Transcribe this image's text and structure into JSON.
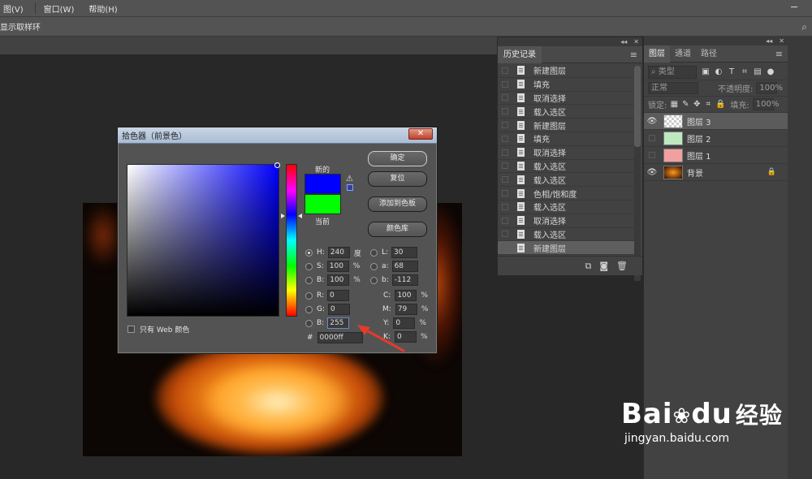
{
  "menubar": {
    "items": [
      "图(V)",
      "窗口(W)",
      "帮助(H)"
    ]
  },
  "options": {
    "label": "显示取样环"
  },
  "history": {
    "tab": "历史记录",
    "items": [
      "新建图层",
      "填充",
      "取消选择",
      "载入选区",
      "新建图层",
      "填充",
      "取消选择",
      "载入选区",
      "载入选区",
      "色相/饱和度",
      "载入选区",
      "取消选择",
      "载入选区",
      "新建图层"
    ],
    "selected_index": 13
  },
  "layers": {
    "tabs": [
      "图层",
      "通道",
      "路径"
    ],
    "kind_label": "类型",
    "blend_mode": "正常",
    "opacity_label": "不透明度:",
    "opacity_value": "100%",
    "lock_label": "锁定:",
    "fill_label": "填充:",
    "fill_value": "100%",
    "items": [
      {
        "name": "图层 3",
        "visible": true,
        "selected": true
      },
      {
        "name": "图层 2",
        "visible": false,
        "selected": false
      },
      {
        "name": "图层 1",
        "visible": false,
        "selected": false
      },
      {
        "name": "背景",
        "visible": true,
        "selected": false,
        "locked": true
      }
    ]
  },
  "dialog": {
    "title": "拾色器（前景色）",
    "close": "✕",
    "new_label": "新的",
    "current_label": "当前",
    "new_color": "#0000ff",
    "current_color": "#00ff00",
    "buttons": {
      "ok": "确定",
      "reset": "复位",
      "add_swatch": "添加到色板",
      "color_lib": "颜色库"
    },
    "web_only": "只有 Web 颜色",
    "hsb": {
      "H": "240",
      "H_unit": "度",
      "S": "100",
      "S_unit": "%",
      "B": "100",
      "B_unit": "%"
    },
    "lab": {
      "L": "30",
      "a": "68",
      "b": "-112"
    },
    "rgb": {
      "R": "0",
      "G": "0",
      "B": "255"
    },
    "cmyk": {
      "C": "100",
      "M": "79",
      "Y": "0",
      "K": "0",
      "unit": "%"
    },
    "hex_label": "#",
    "hex": "0000ff"
  },
  "watermark": {
    "brand": "Bai",
    "brand2": "du",
    "product": "经验",
    "url": "jingyan.baidu.com"
  }
}
